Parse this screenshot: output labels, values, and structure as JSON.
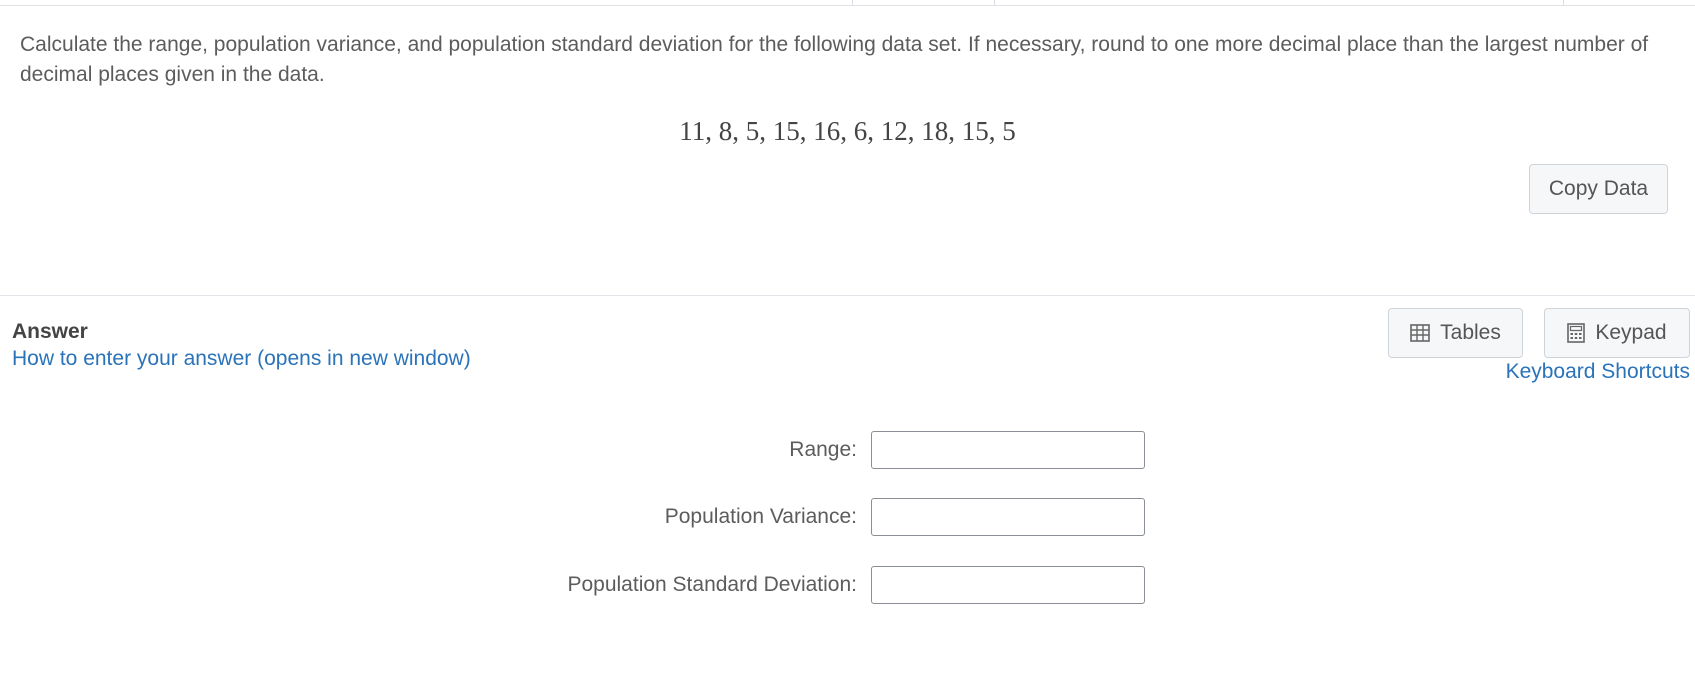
{
  "question": {
    "text": "Calculate the range, population variance, and population standard deviation for the following data set. If necessary, round to one more decimal place than the largest number of decimal places given in the data.",
    "data_set": "11, 8, 5, 15, 16, 6, 12, 18, 15, 5",
    "copy_button_label": "Copy Data"
  },
  "answer": {
    "heading": "Answer",
    "help_link": "How to enter your answer (opens in new window)",
    "tables_label": "Tables",
    "keypad_label": "Keypad",
    "shortcuts_link": "Keyboard Shortcuts",
    "fields": [
      {
        "label": "Range:",
        "value": ""
      },
      {
        "label": "Population Variance:",
        "value": ""
      },
      {
        "label": "Population Standard Deviation:",
        "value": ""
      }
    ]
  },
  "icons": {
    "tables": "table-icon",
    "keypad": "calculator-icon"
  },
  "colors": {
    "link": "#2a73b9",
    "button_bg": "#f6f7f9",
    "text": "#5c5c5c"
  }
}
